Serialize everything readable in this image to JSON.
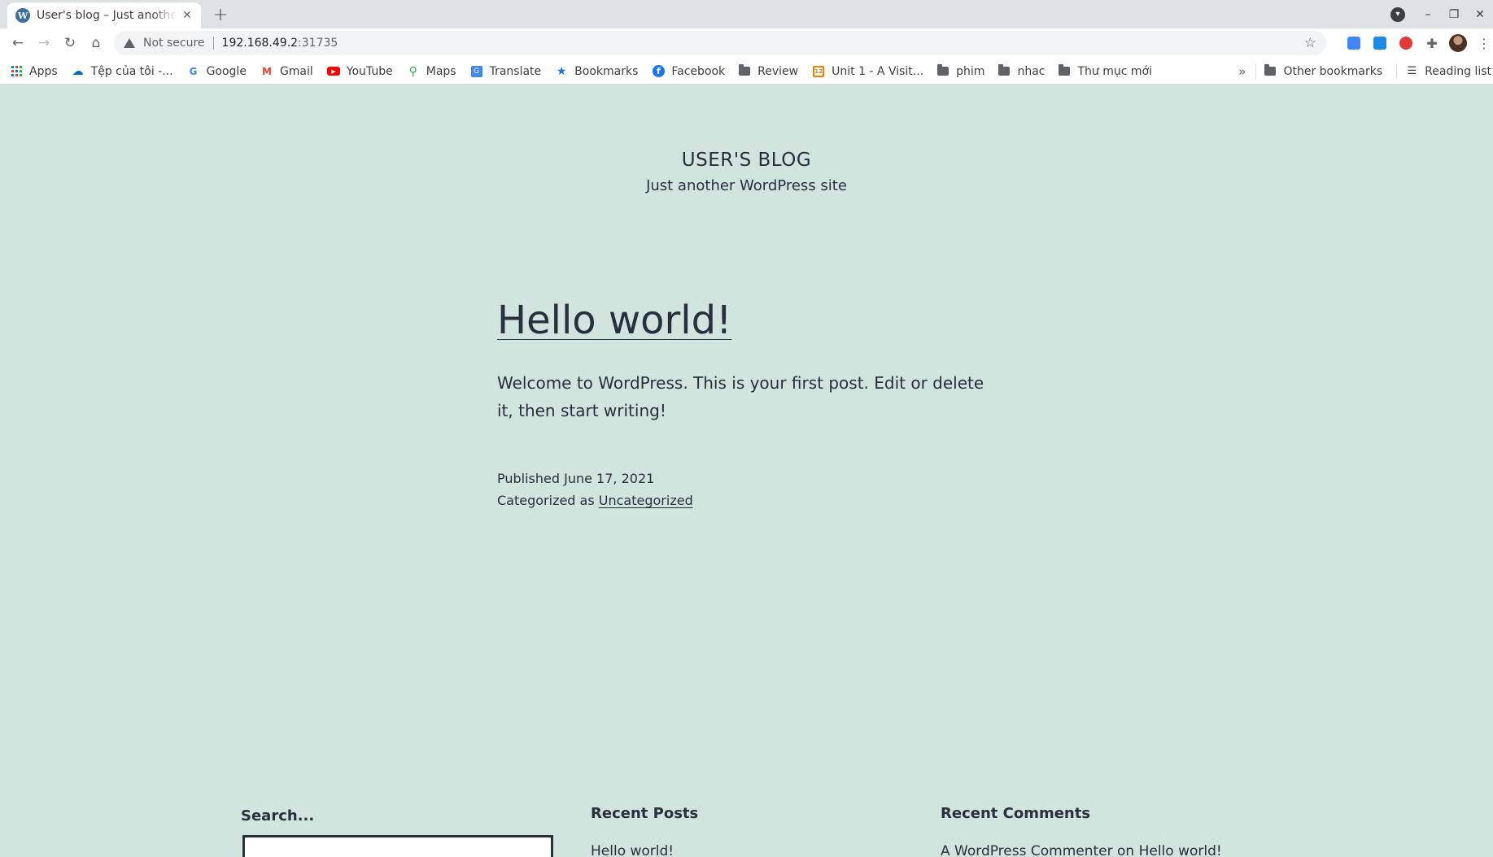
{
  "browser": {
    "tab": {
      "title": "User's blog – Just another WordPress site",
      "favicon": "W"
    },
    "new_tab_label": "+",
    "address": {
      "security_label": "Not secure",
      "host": "192.168.49.2",
      "port": ":31735"
    },
    "bookmarks": [
      {
        "label": "Apps",
        "icon": "apps-grid-icon"
      },
      {
        "label": "Tệp của tôi -...",
        "icon": "onedrive-icon"
      },
      {
        "label": "Google",
        "icon": "google-icon"
      },
      {
        "label": "Gmail",
        "icon": "gmail-icon"
      },
      {
        "label": "YouTube",
        "icon": "youtube-icon"
      },
      {
        "label": "Maps",
        "icon": "maps-icon"
      },
      {
        "label": "Translate",
        "icon": "translate-icon"
      },
      {
        "label": "Bookmarks",
        "icon": "star-icon"
      },
      {
        "label": "Facebook",
        "icon": "facebook-icon"
      },
      {
        "label": "Review",
        "icon": "folder-icon"
      },
      {
        "label": "Unit 1 - A Visit...",
        "icon": "unit-icon"
      },
      {
        "label": "phim",
        "icon": "folder-icon"
      },
      {
        "label": "nhac",
        "icon": "folder-icon"
      },
      {
        "label": "Thư mục mới",
        "icon": "folder-icon"
      }
    ],
    "other_bookmarks": "Other bookmarks",
    "reading_list": "Reading list",
    "colors": {
      "tabstrip": "#dee1e6",
      "omnibox": "#f1f3f4"
    }
  },
  "site": {
    "title": "USER'S BLOG",
    "description": "Just another WordPress site",
    "background": "#d1e4dd"
  },
  "post": {
    "title": "Hello world!",
    "body": "Welcome to WordPress. This is your first post. Edit or delete it, then start writing!",
    "published": "Published June 17, 2021",
    "category_prefix": "Categorized as ",
    "category": "Uncategorized"
  },
  "widgets": {
    "search": {
      "label": "Search..."
    },
    "recent_posts": {
      "title": "Recent Posts",
      "items": [
        "Hello world!"
      ]
    },
    "recent_comments": {
      "title": "Recent Comments",
      "items": [
        "A WordPress Commenter on Hello world!"
      ]
    }
  }
}
